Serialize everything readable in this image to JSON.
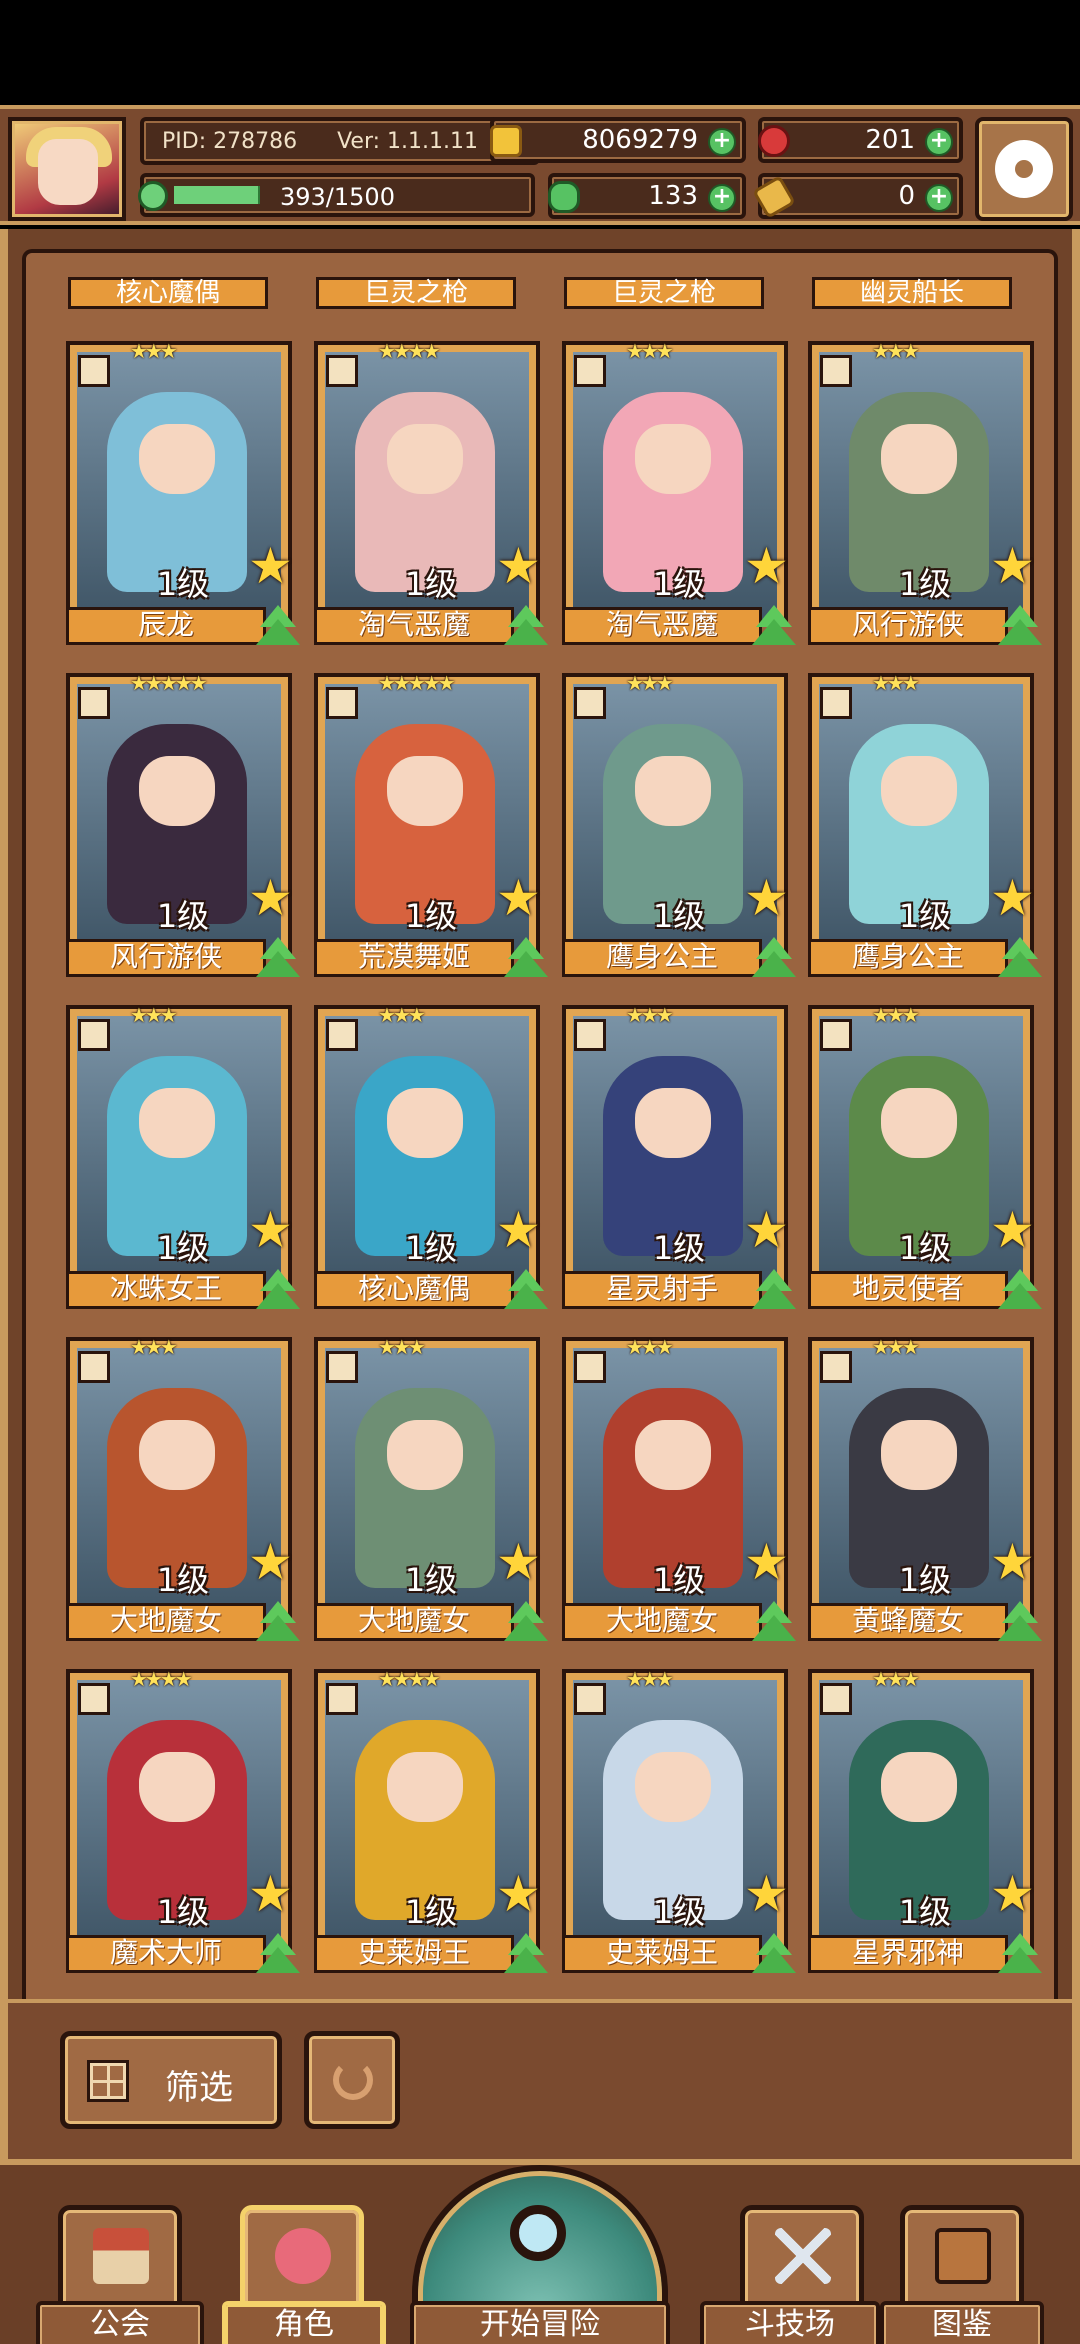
{
  "header": {
    "pid": "PID: 278786",
    "version": "Ver: 1.1.1.11",
    "energy": {
      "text": "393/1500",
      "fraction": 0.262
    },
    "gold": "8069279",
    "gems": "201",
    "clover": "133",
    "keys": "0",
    "icons": {
      "gold": "gold-coin-icon",
      "gems": "red-gem-icon",
      "clover": "clover-icon",
      "keys": "key-icon",
      "settings": "gear-icon"
    }
  },
  "top_row_names": [
    "核心魔偶",
    "巨灵之枪",
    "巨灵之枪",
    "幽灵船长"
  ],
  "cards": [
    {
      "name": "辰龙",
      "level": "1级",
      "stars": "★★★",
      "color": "#7fbfd8"
    },
    {
      "name": "淘气恶魔",
      "level": "1级",
      "stars": "★★★★",
      "color": "#e9b9b8"
    },
    {
      "name": "淘气恶魔",
      "level": "1级",
      "stars": "★★★",
      "color": "#f2a7b6"
    },
    {
      "name": "风行游侠",
      "level": "1级",
      "stars": "★★★",
      "color": "#6f8a6a"
    },
    {
      "name": "风行游侠",
      "level": "1级",
      "stars": "★★★★★",
      "color": "#3a2a3e"
    },
    {
      "name": "荒漠舞姬",
      "level": "1级",
      "stars": "★★★★★",
      "color": "#d7623e"
    },
    {
      "name": "鹰身公主",
      "level": "1级",
      "stars": "★★★",
      "color": "#6f9a8c"
    },
    {
      "name": "鹰身公主",
      "level": "1级",
      "stars": "★★★",
      "color": "#8fd3d8"
    },
    {
      "name": "冰蛛女王",
      "level": "1级",
      "stars": "★★★",
      "color": "#5bb8d0"
    },
    {
      "name": "核心魔偶",
      "level": "1级",
      "stars": "★★★",
      "color": "#3aa6c8"
    },
    {
      "name": "星灵射手",
      "level": "1级",
      "stars": "★★★",
      "color": "#35427a"
    },
    {
      "name": "地灵使者",
      "level": "1级",
      "stars": "★★★",
      "color": "#5c8a4a"
    },
    {
      "name": "大地魔女",
      "level": "1级",
      "stars": "★★★",
      "color": "#b8552e"
    },
    {
      "name": "大地魔女",
      "level": "1级",
      "stars": "★★★",
      "color": "#6e8f74"
    },
    {
      "name": "大地魔女",
      "level": "1级",
      "stars": "★★★",
      "color": "#b0402e"
    },
    {
      "name": "黄蜂魔女",
      "level": "1级",
      "stars": "★★★",
      "color": "#3a3a44"
    },
    {
      "name": "魔术大师",
      "level": "1级",
      "stars": "★★★★",
      "color": "#b8303a"
    },
    {
      "name": "史莱姆王",
      "level": "1级",
      "stars": "★★★★",
      "color": "#e0a82a"
    },
    {
      "name": "史莱姆王",
      "level": "1级",
      "stars": "★★★",
      "color": "#c8d8e8"
    },
    {
      "name": "星界邪神",
      "level": "1级",
      "stars": "★★★",
      "color": "#2f6a5a"
    }
  ],
  "controls": {
    "filter_label": "筛选"
  },
  "nav": {
    "guild": "公会",
    "character": "角色",
    "adventure": "开始冒险",
    "arena": "斗技场",
    "codex": "图鉴"
  }
}
